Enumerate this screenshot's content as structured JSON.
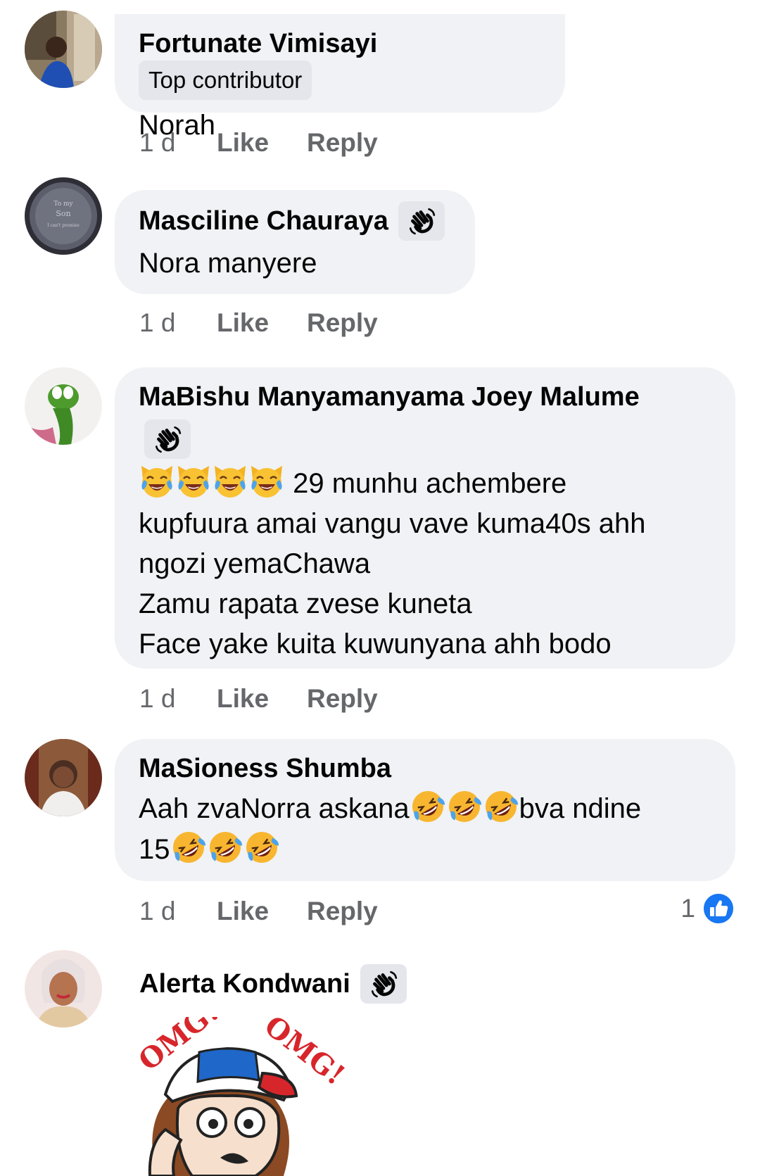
{
  "comments": [
    {
      "name": "Fortunate Vimisayi",
      "badge": "Top contributor",
      "text": "Norah",
      "time": "1 d",
      "like_label": "Like",
      "reply_label": "Reply"
    },
    {
      "name": "Masciline Chauraya",
      "badge_icon": "wave-icon",
      "text": "Nora manyere",
      "time": "1 d",
      "like_label": "Like",
      "reply_label": "Reply"
    },
    {
      "name": "MaBishu Manyamanyama Joey Malume",
      "badge_icon": "wave-icon",
      "lines": [
        "29 munhu achembere",
        "kupfuura amai vangu vave kuma40s ahh",
        "ngozi yemaChawa",
        "Zamu rapata zvese kuneta",
        "Face yake kuita kuwunyana ahh bodo"
      ],
      "emoji": "crying-laughing-cat-emoji",
      "time": "1 d",
      "like_label": "Like",
      "reply_label": "Reply"
    },
    {
      "name": "MaSioness Shumba",
      "text_part1": "Aah zvaNorra askana",
      "text_part2": "bva ndine",
      "text_part3": "15",
      "emoji": "rolling-on-floor-laughing-emoji",
      "time": "1 d",
      "like_label": "Like",
      "reply_label": "Reply",
      "reaction_count": "1",
      "reaction_icon": "thumbs-up-icon"
    },
    {
      "name": "Alerta Kondwani",
      "badge_icon": "wave-icon",
      "sticker": "OMG! OMG!"
    }
  ],
  "colors": {
    "bubble": "#f0f2f5",
    "badge_bg": "#e4e6eb",
    "meta_text": "#65676b",
    "like_blue": "#1877f2",
    "sticker_red": "#d7262b"
  }
}
